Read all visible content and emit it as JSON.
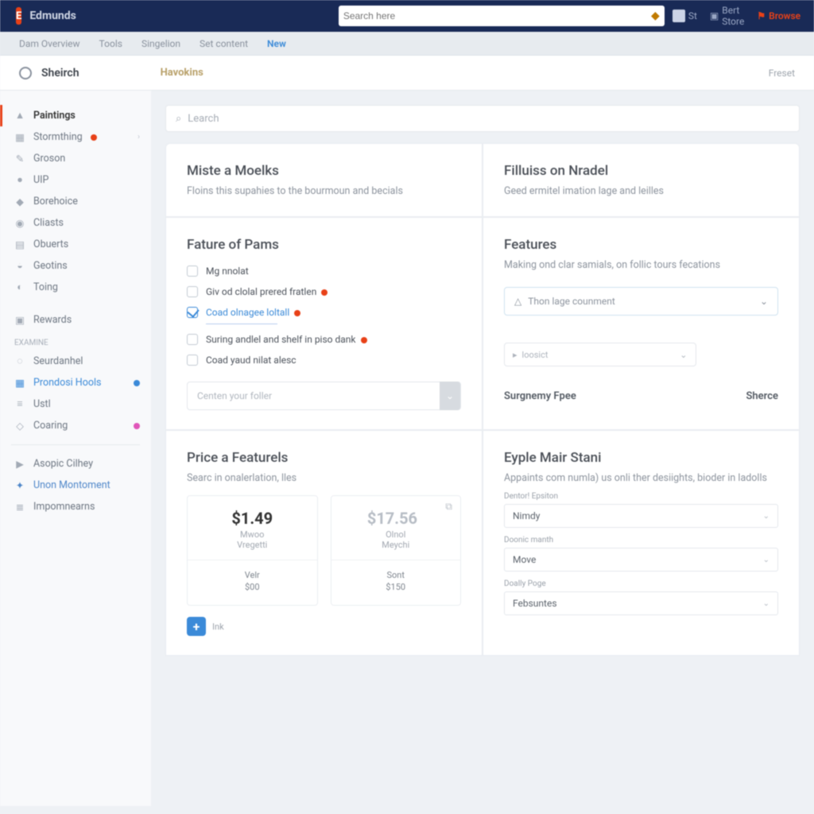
{
  "top": {
    "brand": "Edmunds",
    "search_placeholder": "Search here",
    "right": {
      "m1": "St",
      "m2": "Bert Store",
      "m3": "Browse"
    }
  },
  "subnav": {
    "i1": "Dam Overview",
    "i2": "Tools",
    "i3": "Singelion",
    "i4": "Set content",
    "i5": "New"
  },
  "pagehead": {
    "title": "Sheirch",
    "tag": "Havokins",
    "end": "Freset"
  },
  "sidebar": {
    "g1": [
      {
        "label": "Paintings"
      },
      {
        "label": "Stormthing"
      },
      {
        "label": "Groson"
      },
      {
        "label": "UIP"
      },
      {
        "label": "Borehoice"
      },
      {
        "label": "Cliasts"
      },
      {
        "label": "Obuerts"
      },
      {
        "label": "Geotins"
      },
      {
        "label": "Toing"
      }
    ],
    "g2_label": "Rewards",
    "sect": "Examine",
    "g3": [
      {
        "label": "Seurdanhel"
      },
      {
        "label": "Prondosi Hools"
      },
      {
        "label": "Ustl"
      },
      {
        "label": "Coaring"
      }
    ],
    "g4": [
      {
        "label": "Asopic Cilhey"
      },
      {
        "label": "Unon Montoment"
      },
      {
        "label": "Impomnearns"
      }
    ]
  },
  "main_search_placeholder": "Learch",
  "cards": {
    "c1": {
      "title": "Miste a Moelks",
      "sub": "Floins this supahies to the bourmoun and becials"
    },
    "c2": {
      "title": "Filluiss on Nradel",
      "sub": "Geed ermitel imation lage and leilles"
    },
    "c3": {
      "title": "Fature of Pams",
      "items": [
        "Mg nnolat",
        "Giv od clolal prered fratlen",
        "Coad olnagee loltall",
        "Suring andlel and shelf in piso dank",
        "Coad yaud nilat alesc"
      ],
      "select_placeholder": "Centen your foller"
    },
    "c4": {
      "title": "Features",
      "sub": "Making ond clar samials, on follic tours fecations",
      "sel1": "Thon lage counment",
      "sel2": "loosict",
      "foot1": "Surgnemy Fpee",
      "foot2": "Sherce"
    },
    "c5": {
      "title": "Price a Featurels",
      "sub": "Searc in onalerlation, lles",
      "cards": [
        {
          "price": "$1.49",
          "l1": "Mwoo",
          "l2": "Vregetti",
          "s1": "Velr",
          "s2": "$00"
        },
        {
          "price": "$17.56",
          "l1": "Olnol",
          "l2": "Meychi",
          "s1": "Sont",
          "s2": "$150"
        }
      ],
      "add": "Ink"
    },
    "c6": {
      "title": "Eyple Mair Stani",
      "sub": "Appaints com numla) us onli ther desiights, bioder in ladolls",
      "f1_label": "Dentor! Epsiton",
      "f1": "Nimdy",
      "f2_label": "Doonic manth",
      "f2": "Move",
      "f3_label": "Doally Poge",
      "f3": "Febsuntes"
    }
  }
}
